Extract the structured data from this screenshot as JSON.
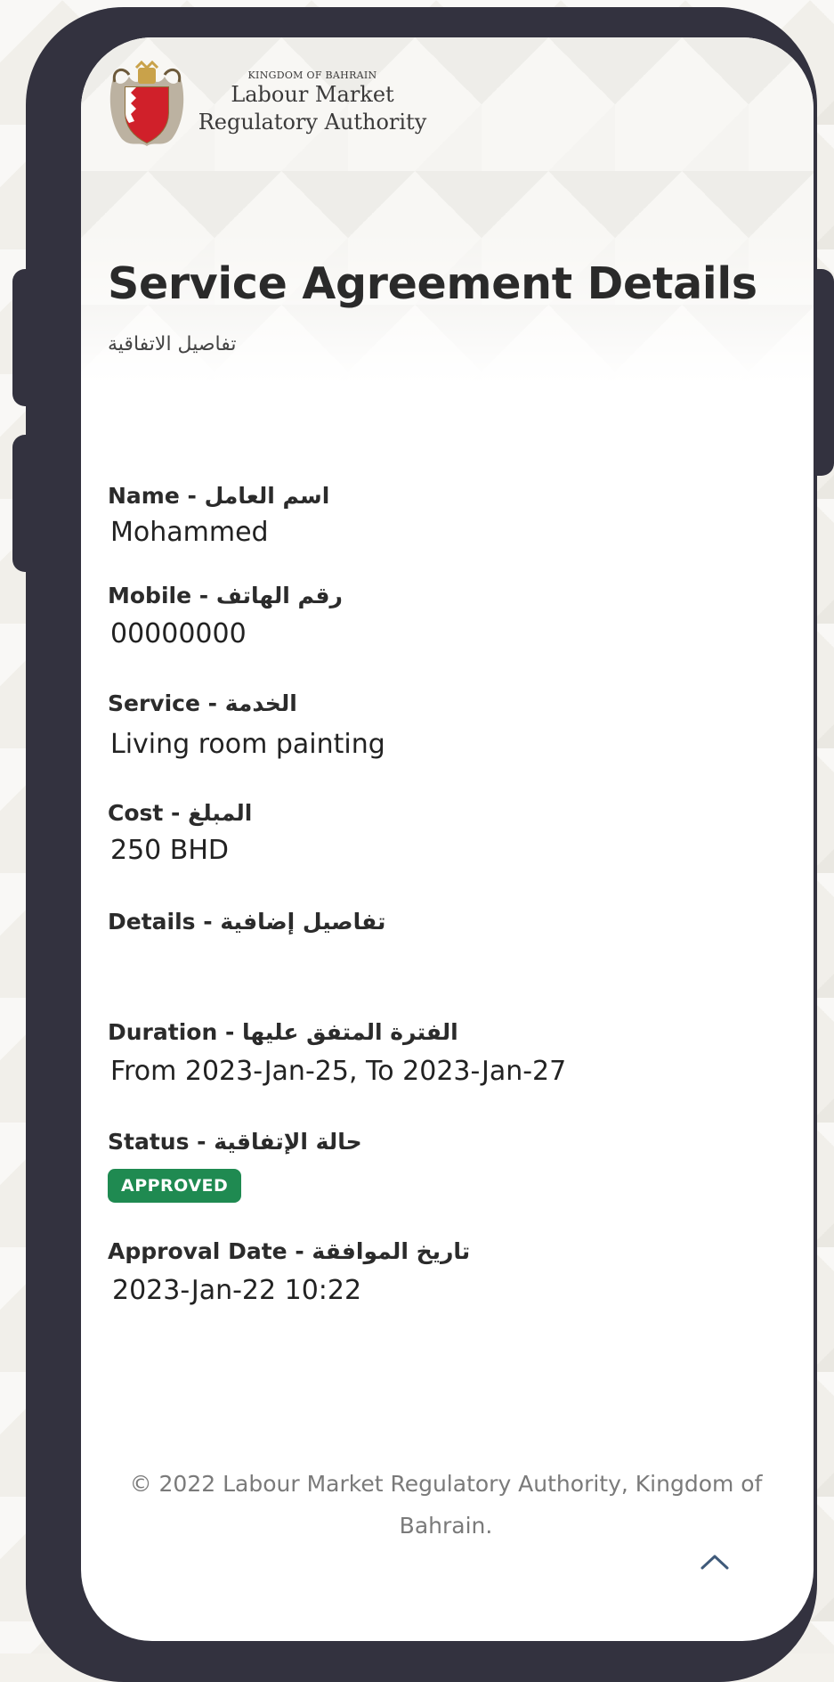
{
  "header": {
    "logo_icon": "bahrain-coat-of-arms",
    "org_kingdom": "KINGDOM OF BAHRAIN",
    "org_name_line1": "Labour Market",
    "org_name_line2": "Regulatory Authority"
  },
  "page": {
    "title": "Service Agreement Details",
    "subtitle_ar": "تفاصيل الاتفاقية"
  },
  "fields": {
    "name": {
      "label": "Name - اسم العامل",
      "value": "Mohammed"
    },
    "mobile": {
      "label": "Mobile - رقم الهاتف",
      "value": "00000000"
    },
    "service": {
      "label": "Service - الخدمة",
      "value": "Living room painting"
    },
    "cost": {
      "label": "Cost - المبلغ",
      "value": "250 BHD"
    },
    "details": {
      "label": "Details - تفاصيل إضافية",
      "value": ""
    },
    "duration": {
      "label": "Duration - الفترة المتفق عليها",
      "value": "From 2023-Jan-25, To 2023-Jan-27"
    },
    "status": {
      "label": "Status - حالة الإتفاقية",
      "badge": "APPROVED",
      "badge_color": "#1f8a51"
    },
    "approval_date": {
      "label": "Approval Date - تاريخ الموافقة",
      "value": "2023-Jan-22 10:22"
    }
  },
  "footer": {
    "copyright": "© 2022 Labour Market Regulatory Authority, Kingdom of Bahrain.",
    "scroll_top_icon": "chevron-up-icon"
  },
  "colors": {
    "frame": "#33323f",
    "accent_green": "#1f8a51"
  }
}
